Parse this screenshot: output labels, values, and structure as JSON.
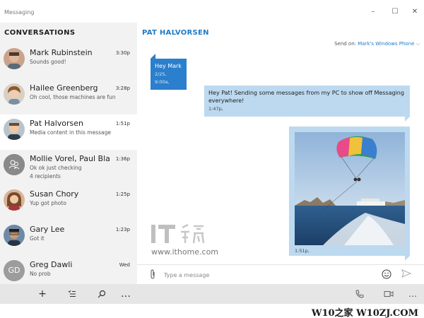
{
  "window": {
    "title": "Messaging",
    "controls": [
      "minimize-icon",
      "maximize-icon",
      "close-icon"
    ]
  },
  "conversations": {
    "header": "CONVERSATIONS",
    "items": [
      {
        "name": "Mark Rubinstein",
        "time": "3:30p",
        "preview": "Sounds good!",
        "avatar": "photo"
      },
      {
        "name": "Hailee Greenberg",
        "time": "3:28p",
        "preview": "Oh cool, those machines are fun",
        "avatar": "photo"
      },
      {
        "name": "Pat Halvorsen",
        "time": "1:51p",
        "preview": "Media content in this message",
        "avatar": "photo",
        "selected": true
      },
      {
        "name": "Mollie Vorel, Paul Bla",
        "time": "1:36p",
        "preview": "Ok ok just checking",
        "sub": "4 recipients",
        "avatar": "group-icon"
      },
      {
        "name": "Susan Chory",
        "time": "1:25p",
        "preview": "Yup got photo",
        "avatar": "photo"
      },
      {
        "name": "Gary Lee",
        "time": "1:23p",
        "preview": "Got it",
        "avatar": "photo"
      },
      {
        "name": "Greg Dawli",
        "time": "Wed",
        "preview": "No prob",
        "avatar_initials": "GD"
      }
    ]
  },
  "left_toolbar": {
    "icons": [
      "new-message-icon",
      "select-icon",
      "search-icon",
      "more-icon"
    ]
  },
  "chat": {
    "contact_name": "PAT HALVORSEN",
    "send_on_label": "Send on:",
    "send_on_value": "Mark's Windows Phone",
    "messages": [
      {
        "direction": "in",
        "text": "Hey Mark",
        "time": "2/25, 9:00a,"
      },
      {
        "direction": "out",
        "text": "Hey Pat! Sending some messages from my PC to show off Messaging everywhere!",
        "time": "1:47p,"
      },
      {
        "direction": "out",
        "type": "image",
        "image_description": "parasailing over the ocean",
        "time": "1:51p,"
      }
    ],
    "compose_placeholder": "Type a message"
  },
  "right_toolbar": {
    "icons": [
      "phone-icon",
      "video-icon",
      "more-icon"
    ]
  },
  "watermarks": {
    "logo_text": "IT之家",
    "url": "www.ithome.com",
    "footer": "W10之家 W10ZJ.COM"
  },
  "colors": {
    "accent": "#1e7bc7",
    "incoming_bubble": "#2b7fcc",
    "outgoing_bubble": "#bcd9f0",
    "pane_background": "#f2f2f2",
    "toolbar_background": "#e6e6e6"
  }
}
